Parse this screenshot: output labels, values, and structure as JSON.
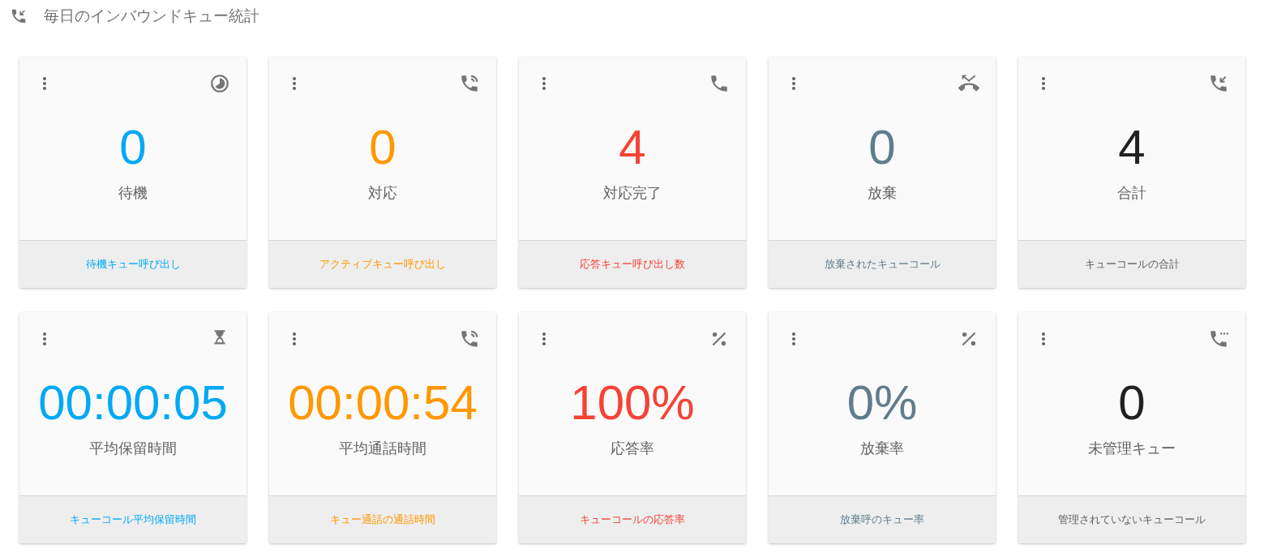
{
  "title": "毎日のインバウンドキュー統計",
  "cards": [
    {
      "kind": "clock",
      "value": "0",
      "label": "待機",
      "footer": "待機キュー呼び出し",
      "color": "#03a9f4"
    },
    {
      "kind": "ringing",
      "value": "0",
      "label": "対応",
      "footer": "アクティブキュー呼び出し",
      "color": "#ff9800"
    },
    {
      "kind": "phone",
      "value": "4",
      "label": "対応完了",
      "footer": "応答キュー呼び出し数",
      "color": "#f44336"
    },
    {
      "kind": "missed",
      "value": "0",
      "label": "放棄",
      "footer": "放棄されたキューコール",
      "color": "#607d8b"
    },
    {
      "kind": "incoming",
      "value": "4",
      "label": "合計",
      "footer": "キューコールの合計",
      "color": "#212121"
    },
    {
      "kind": "hourglass",
      "value": "00:00:05",
      "label": "平均保留時間",
      "footer": "キューコール平均保留時間",
      "color": "#03a9f4"
    },
    {
      "kind": "ringing",
      "value": "00:00:54",
      "label": "平均通話時間",
      "footer": "キュー通話の通話時間",
      "color": "#ff9800"
    },
    {
      "kind": "percent",
      "value": "100%",
      "label": "応答率",
      "footer": "キューコールの応答率",
      "color": "#f44336"
    },
    {
      "kind": "percent",
      "value": "0%",
      "label": "放棄率",
      "footer": "放棄呼のキュー率",
      "color": "#607d8b"
    },
    {
      "kind": "paused",
      "value": "0",
      "label": "未管理キュー",
      "footer": "管理されていないキューコール",
      "color": "#212121"
    }
  ]
}
